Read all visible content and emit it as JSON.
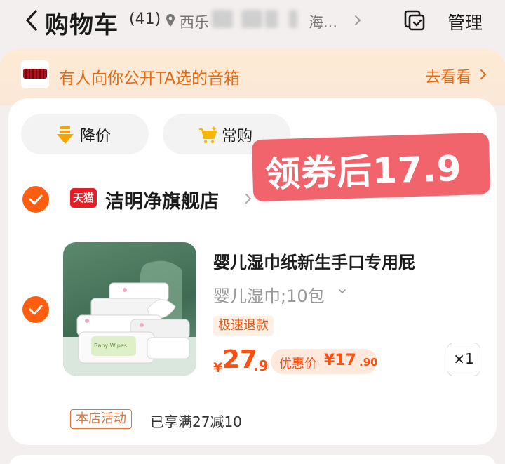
{
  "header": {
    "title": "购物车",
    "count": "(41)",
    "location": "西乐",
    "location_tail": "海...",
    "manage_label": "管理"
  },
  "banner": {
    "text": "有人向你公开TA选的音箱",
    "link_label": "去看看"
  },
  "chips": [
    {
      "label": "降价",
      "icon": "price-drop-icon"
    },
    {
      "label": "常购",
      "icon": "frequent-cart-icon"
    }
  ],
  "promo_overlay": {
    "text": "领券后17.9"
  },
  "store": {
    "badge": "天猫",
    "name": "洁明净旗舰店"
  },
  "product": {
    "title": "婴儿湿巾纸新生手口专用屁",
    "sku": "婴儿湿巾;10包",
    "tag": "极速退款",
    "price_symbol": "¥",
    "price_int": "27",
    "price_dec": ".9",
    "discount_label": "优惠价",
    "discount_amount": "¥17",
    "discount_dec": ".90",
    "quantity": "×1",
    "image_label": "Baby Wipes"
  },
  "activity": {
    "tag": "本店活动",
    "text": "已享满27减10"
  },
  "colors": {
    "accent": "#ff5e11",
    "promo_red": "#f2646c",
    "banner_orange": "#e36a14"
  }
}
